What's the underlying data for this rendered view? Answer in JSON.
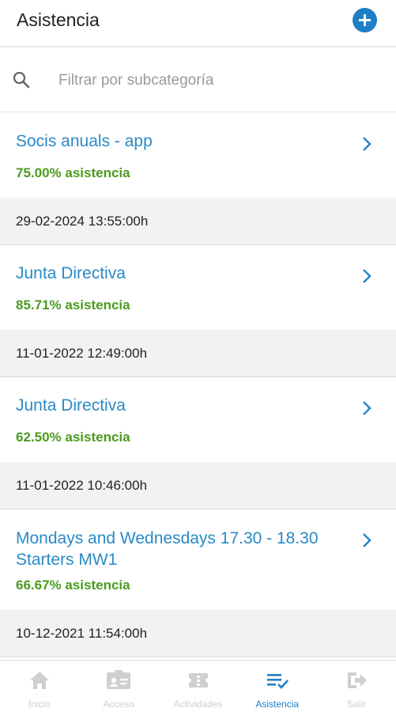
{
  "header": {
    "title": "Asistencia",
    "add_icon": "plus-circle-icon"
  },
  "search": {
    "placeholder": "Filtrar por subcategoría",
    "value": "",
    "icon": "search-icon"
  },
  "items": [
    {
      "name": "Socis anuals - app",
      "attendance": "75.00% asistencia",
      "date": "29-02-2024 13:55:00h"
    },
    {
      "name": "Junta Directiva",
      "attendance": "85.71% asistencia",
      "date": "11-01-2022 12:49:00h"
    },
    {
      "name": "Junta Directiva",
      "attendance": "62.50% asistencia",
      "date": "11-01-2022 10:46:00h"
    },
    {
      "name": "Mondays and Wednesdays 17.30 - 18.30 Starters MW1",
      "attendance": "66.67% asistencia",
      "date": "10-12-2021 11:54:00h"
    }
  ],
  "tabs": [
    {
      "label": "Inicio",
      "icon": "home-icon",
      "active": false
    },
    {
      "label": "Acceso",
      "icon": "id-card-icon",
      "active": false
    },
    {
      "label": "Actividades",
      "icon": "ticket-icon",
      "active": false
    },
    {
      "label": "Asistencia",
      "icon": "checklist-icon",
      "active": true
    },
    {
      "label": "Salir",
      "icon": "logout-icon",
      "active": false
    }
  ],
  "colors": {
    "accent": "#1f7fc6",
    "link": "#2a8ac6",
    "attendance": "#4a9a1e",
    "inactive_tab": "#cfcfcf"
  }
}
